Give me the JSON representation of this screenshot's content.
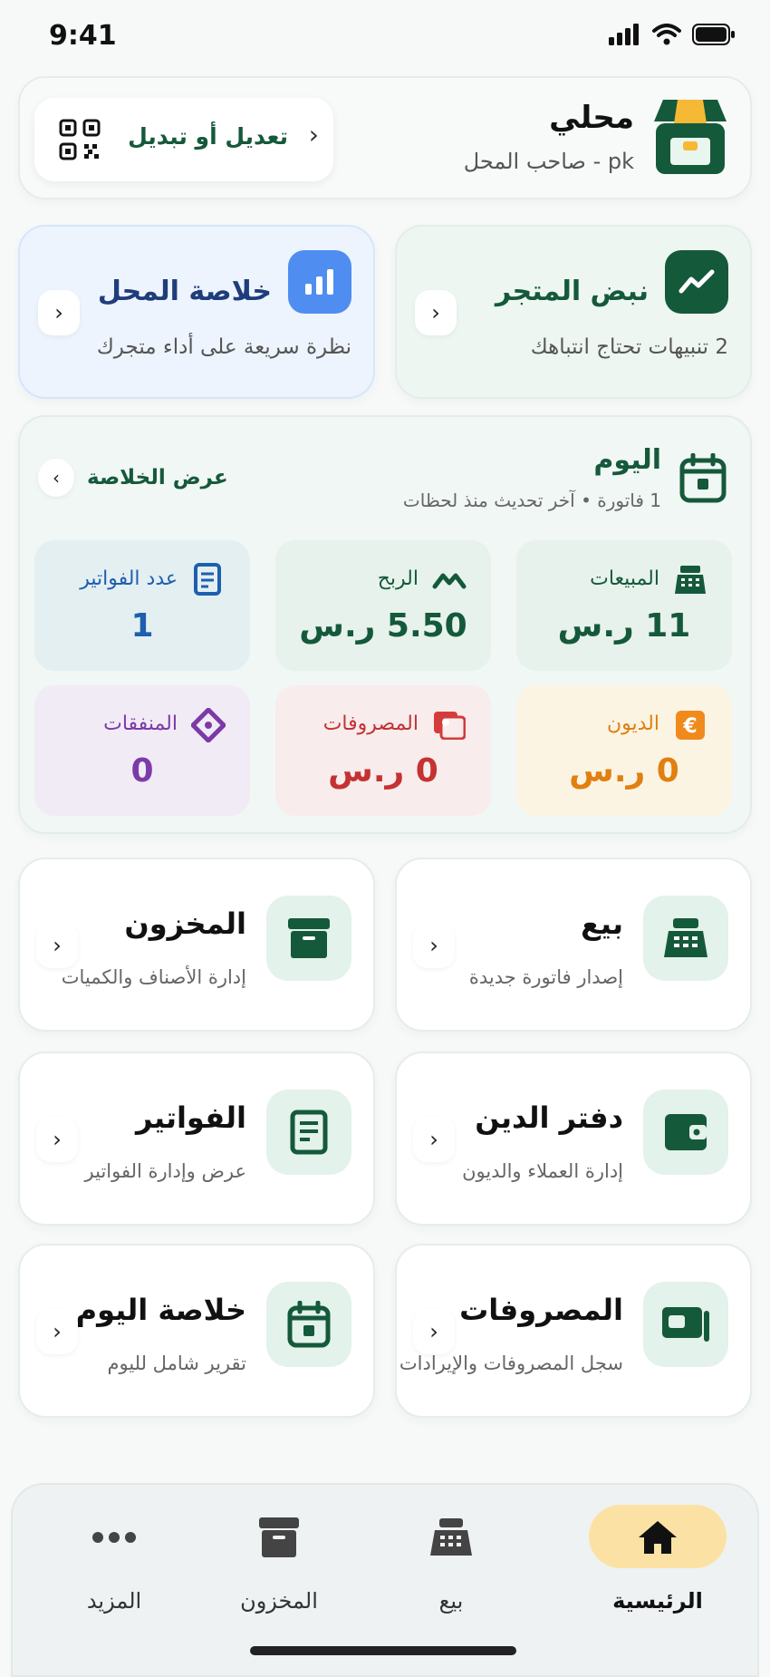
{
  "status_bar": {
    "time": "9:41"
  },
  "header": {
    "shop_name": "محلي",
    "subtitle": "pk - صاحب المحل",
    "edit_label": "تعديل أو تبديل",
    "icons": {
      "logo": "store-icon",
      "qr": "qr-code-icon"
    }
  },
  "feature_cards": {
    "pulse": {
      "title": "نبض المتجر",
      "subtitle": "2 تنبيهات تحتاج انتباهك",
      "icon": "trend-line-icon"
    },
    "summary": {
      "title": "خلاصة المحل",
      "subtitle": "نظرة سريعة على أداء متجرك",
      "icon": "bar-chart-icon"
    }
  },
  "today": {
    "title": "اليوم",
    "subtitle": "1 فاتورة • آخر تحديث منذ لحظات",
    "view_summary": "عرض الخلاصة",
    "stats": {
      "sales": {
        "label": "المبيعات",
        "value": "11 ر.س"
      },
      "profit": {
        "label": "الربح",
        "value": "5.50 ر.س"
      },
      "invoice_count": {
        "label": "عدد الفواتير",
        "value": "1"
      },
      "debts": {
        "label": "الديون",
        "value": "0 ر.س"
      },
      "expenses": {
        "label": "المصروفات",
        "value": "0 ر.س"
      },
      "spent": {
        "label": "المنفقات",
        "value": "0"
      }
    }
  },
  "menu": [
    {
      "title": "بيع",
      "subtitle": "إصدار فاتورة جديدة",
      "icon": "cash-register-icon"
    },
    {
      "title": "المخزون",
      "subtitle": "إدارة الأصناف والكميات",
      "icon": "archive-box-icon"
    },
    {
      "title": "دفتر الدين",
      "subtitle": "إدارة العملاء والديون",
      "icon": "wallet-icon"
    },
    {
      "title": "الفواتير",
      "subtitle": "عرض وإدارة الفواتير",
      "icon": "receipt-icon"
    },
    {
      "title": "المصروفات",
      "subtitle": "سجل المصروفات والإيرادات",
      "icon": "banknote-icon"
    },
    {
      "title": "خلاصة اليوم",
      "subtitle": "تقرير شامل لليوم",
      "icon": "calendar-icon"
    }
  ],
  "bottom_nav": [
    {
      "label": "الرئيسية",
      "icon": "home-icon",
      "active": true
    },
    {
      "label": "بيع",
      "icon": "cash-register-icon",
      "active": false
    },
    {
      "label": "المخزون",
      "icon": "archive-box-icon",
      "active": false
    },
    {
      "label": "المزيد",
      "icon": "more-dots-icon",
      "active": false
    }
  ],
  "colors": {
    "primary_green": "#15593b",
    "accent_yellow": "#fbe2a4",
    "blue": "#4f8ef0",
    "orange": "#f08a1c",
    "red": "#d43b3b",
    "purple": "#7c3aa8"
  }
}
